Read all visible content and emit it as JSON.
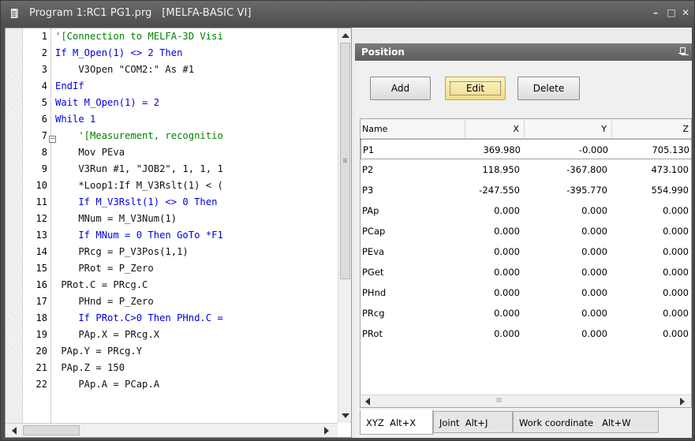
{
  "window": {
    "title": "Program 1:RC1 PG1.prg   [MELFA-BASIC VI]",
    "minimize": "–",
    "maximize": "□",
    "close": "✕"
  },
  "editor": {
    "line_numbers": [
      "1",
      "2",
      "3",
      "4",
      "5",
      "6",
      "7",
      "8",
      "9",
      "10",
      "11",
      "12",
      "13",
      "14",
      "15",
      "16",
      "17",
      "18",
      "19",
      "20",
      "21",
      "22"
    ],
    "lines": [
      "'[Connection to MELFA-3D Visi",
      "If M_Open(1) <> 2 Then",
      "    V3Open \"COM2:\" As #1",
      "EndIf",
      "Wait M_Open(1) = 2",
      "While 1",
      "    '[Measurement, recognitio",
      "    Mov PEva",
      "    V3Run #1, \"JOB2\", 1, 1, 1",
      "    *Loop1:If M_V3Rslt(1) < (",
      "    If M_V3Rslt(1) <> 0 Then",
      "    MNum = M_V3Num(1)",
      "    If MNum = 0 Then GoTo *F1",
      "    PRcg = P_V3Pos(1,1)",
      "    PRot = P_Zero",
      " PRot.C = PRcg.C",
      "    PHnd = P_Zero",
      "    If PRot.C>0 Then PHnd.C =",
      "    PAp.X = PRcg.X",
      " PAp.Y = PRcg.Y",
      " PAp.Z = 150",
      "    PAp.A = PCap.A"
    ]
  },
  "position_panel": {
    "title": "Position",
    "buttons": {
      "add": "Add",
      "edit": "Edit",
      "delete": "Delete"
    },
    "columns": [
      "Name",
      "X",
      "Y",
      "Z"
    ],
    "rows": [
      {
        "name": "P1",
        "x": "369.980",
        "y": "-0.000",
        "z": "705.130"
      },
      {
        "name": "P2",
        "x": "118.950",
        "y": "-367.800",
        "z": "473.100"
      },
      {
        "name": "P3",
        "x": "-247.550",
        "y": "-395.770",
        "z": "554.990"
      },
      {
        "name": "PAp",
        "x": "0.000",
        "y": "0.000",
        "z": "0.000"
      },
      {
        "name": "PCap",
        "x": "0.000",
        "y": "0.000",
        "z": "0.000"
      },
      {
        "name": "PEva",
        "x": "0.000",
        "y": "0.000",
        "z": "0.000"
      },
      {
        "name": "PGet",
        "x": "0.000",
        "y": "0.000",
        "z": "0.000"
      },
      {
        "name": "PHnd",
        "x": "0.000",
        "y": "0.000",
        "z": "0.000"
      },
      {
        "name": "PRcg",
        "x": "0.000",
        "y": "0.000",
        "z": "0.000"
      },
      {
        "name": "PRot",
        "x": "0.000",
        "y": "0.000",
        "z": "0.000"
      }
    ],
    "tabs": [
      "XYZ  Alt+X",
      "Joint  Alt+J",
      "Work coordinate   Alt+W"
    ]
  }
}
